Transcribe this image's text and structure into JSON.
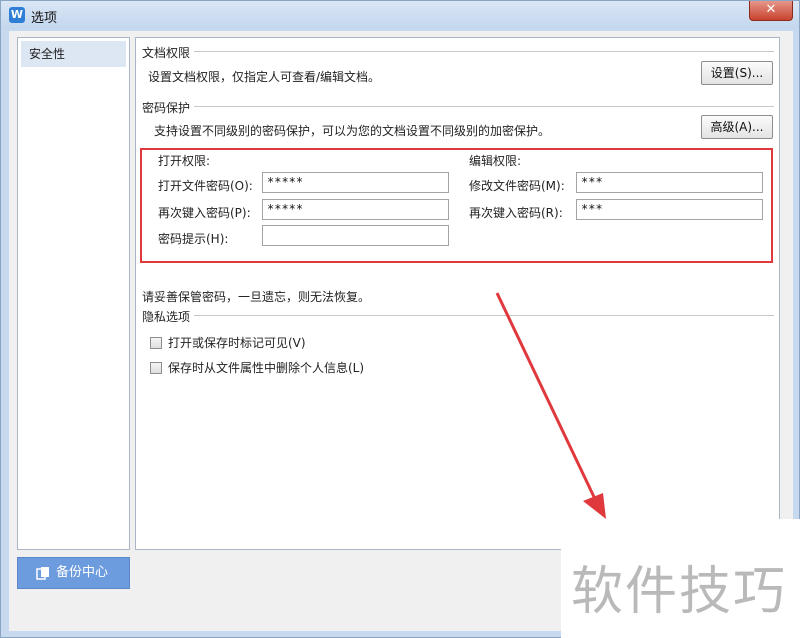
{
  "window": {
    "icon_letter": "W",
    "title": "选项",
    "close_glyph": "✕"
  },
  "sidebar": {
    "items": [
      {
        "label": "安全性",
        "selected": true
      }
    ]
  },
  "backup_button": {
    "label": "备份中心"
  },
  "doc_permission": {
    "heading": "文档权限",
    "description": "设置文档权限，仅指定人可查看/编辑文档。",
    "button": "设置(S)..."
  },
  "password_protect": {
    "heading": "密码保护",
    "description": "支持设置不同级别的密码保护，可以为您的文档设置不同级别的加密保护。",
    "button": "高级(A)...",
    "open": {
      "heading": "打开权限:",
      "password_label": "打开文件密码(O):",
      "password_value": "*****",
      "confirm_label": "再次键入密码(P):",
      "confirm_value": "*****",
      "hint_label": "密码提示(H):",
      "hint_value": ""
    },
    "edit": {
      "heading": "编辑权限:",
      "password_label": "修改文件密码(M):",
      "password_value": "***",
      "confirm_label": "再次键入密码(R):",
      "confirm_value": "***"
    },
    "note": "请妥善保管密码，一旦遗忘，则无法恢复。"
  },
  "privacy": {
    "heading": "隐私选项",
    "options": [
      {
        "label": "打开或保存时标记可见(V)",
        "checked": false
      },
      {
        "label": "保存时从文件属性中删除个人信息(L)",
        "checked": false
      }
    ]
  },
  "watermark": {
    "text": "软件技巧"
  },
  "colors": {
    "highlight_red": "#e0393d",
    "backup_blue": "#6c9bde"
  }
}
